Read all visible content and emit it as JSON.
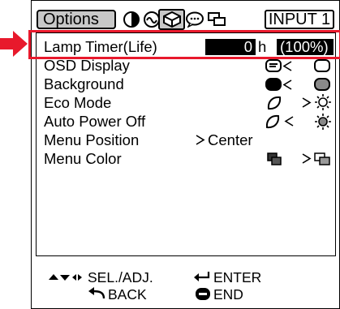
{
  "header": {
    "options_tab": "Options",
    "input_label": "INPUT 1"
  },
  "menu": {
    "items": [
      {
        "label": "Lamp Timer(Life)"
      },
      {
        "label": "OSD Display"
      },
      {
        "label": "Background"
      },
      {
        "label": "Eco Mode"
      },
      {
        "label": "Auto Power Off"
      },
      {
        "label": "Menu Position"
      },
      {
        "label": "Menu Color"
      }
    ],
    "lamp_value": "0",
    "lamp_unit": "h",
    "lamp_percent": "(100%)",
    "menu_position_value": "Center"
  },
  "footer": {
    "sel_adj": "SEL./ADJ.",
    "enter": "ENTER",
    "back": "BACK",
    "end": "END"
  },
  "icons": {
    "tabs": [
      "picture-icon",
      "audio-icon",
      "options-icon",
      "language-icon",
      "display-icon"
    ],
    "pointer": "red-arrow-icon"
  },
  "colors": {
    "highlight": "#e8192c",
    "tab_bg": "#c8c8c8"
  }
}
